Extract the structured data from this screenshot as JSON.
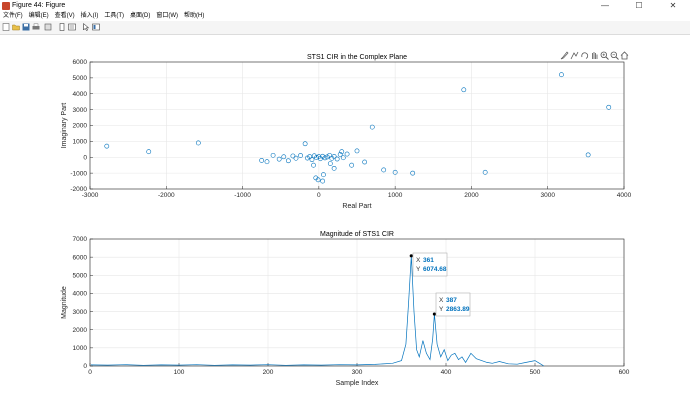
{
  "window": {
    "title": "Figure 44: Figure",
    "minimize_label": "—",
    "maximize_label": "☐",
    "close_label": "✕"
  },
  "menu": [
    "文件(F)",
    "编辑(E)",
    "查看(V)",
    "插入(I)",
    "工具(T)",
    "桌面(D)",
    "窗口(W)",
    "帮助(H)"
  ],
  "toolbar_icons": [
    "new-figure-icon",
    "open-icon",
    "save-icon",
    "print-icon",
    "link-icon",
    "colorbar-icon",
    "legend-icon",
    "pointer-icon",
    "property-inspector-icon"
  ],
  "axes_toolbar_icons": [
    "brush-icon",
    "data-tip-icon",
    "rotate-icon",
    "pan-icon",
    "zoom-in-icon",
    "zoom-out-icon",
    "home-icon"
  ],
  "colors": {
    "series": "#0072bd",
    "grid": "#e6e6e6"
  },
  "chart_data": [
    {
      "type": "scatter",
      "title": "STS1 CIR in the Complex Plane",
      "xlabel": "Real Part",
      "ylabel": "Imaginary Part",
      "xlim": [
        -3000,
        4000
      ],
      "ylim": [
        -2000,
        6000
      ],
      "xticks": [
        "-3000",
        "-2000",
        "-1000",
        "0",
        "1000",
        "2000",
        "3000",
        "4000"
      ],
      "yticks": [
        "-2000",
        "-1000",
        "0",
        "1000",
        "2000",
        "3000",
        "4000",
        "5000",
        "6000"
      ],
      "grid": true,
      "points": [
        [
          -2780,
          700
        ],
        [
          -2230,
          350
        ],
        [
          -1580,
          900
        ],
        [
          -750,
          -200
        ],
        [
          -680,
          -280
        ],
        [
          -600,
          120
        ],
        [
          -520,
          -120
        ],
        [
          -460,
          30
        ],
        [
          -400,
          -220
        ],
        [
          -340,
          80
        ],
        [
          -300,
          -60
        ],
        [
          -240,
          110
        ],
        [
          -180,
          850
        ],
        [
          -150,
          -50
        ],
        [
          -120,
          40
        ],
        [
          -90,
          -150
        ],
        [
          -60,
          90
        ],
        [
          -30,
          -20
        ],
        [
          0,
          40
        ],
        [
          20,
          -90
        ],
        [
          50,
          60
        ],
        [
          80,
          -40
        ],
        [
          110,
          20
        ],
        [
          140,
          120
        ],
        [
          170,
          -70
        ],
        [
          200,
          50
        ],
        [
          240,
          -110
        ],
        [
          280,
          180
        ],
        [
          320,
          -30
        ],
        [
          -70,
          -500
        ],
        [
          -40,
          -1300
        ],
        [
          -10,
          -1420
        ],
        [
          50,
          -1500
        ],
        [
          60,
          -1100
        ],
        [
          150,
          -400
        ],
        [
          200,
          -700
        ],
        [
          300,
          350
        ],
        [
          370,
          200
        ],
        [
          430,
          -500
        ],
        [
          500,
          400
        ],
        [
          600,
          -300
        ],
        [
          700,
          1900
        ],
        [
          850,
          -800
        ],
        [
          1000,
          -950
        ],
        [
          1230,
          -1000
        ],
        [
          1900,
          4250
        ],
        [
          2180,
          -950
        ],
        [
          3180,
          5200
        ],
        [
          3530,
          150
        ],
        [
          3800,
          3150
        ]
      ]
    },
    {
      "type": "line",
      "title": "Magnitude of STS1 CIR",
      "xlabel": "Sample Index",
      "ylabel": "Magnitude",
      "xlim": [
        0,
        600
      ],
      "ylim": [
        0,
        7000
      ],
      "xticks": [
        "0",
        "100",
        "200",
        "300",
        "400",
        "500",
        "600"
      ],
      "yticks": [
        "0",
        "1000",
        "2000",
        "3000",
        "4000",
        "5000",
        "6000",
        "7000"
      ],
      "grid": true,
      "x": [
        1,
        20,
        40,
        60,
        80,
        100,
        120,
        140,
        160,
        180,
        200,
        220,
        240,
        260,
        280,
        300,
        320,
        340,
        350,
        355,
        358,
        361,
        364,
        367,
        370,
        374,
        378,
        382,
        385,
        387,
        390,
        394,
        398,
        402,
        406,
        410,
        414,
        418,
        422,
        428,
        434,
        440,
        446,
        452,
        460,
        470,
        480,
        490,
        500,
        505,
        510
      ],
      "y": [
        60,
        50,
        70,
        40,
        60,
        50,
        70,
        40,
        60,
        50,
        70,
        40,
        60,
        50,
        70,
        60,
        90,
        150,
        300,
        1200,
        3500,
        6074.68,
        3000,
        900,
        500,
        1400,
        700,
        350,
        1500,
        2863.89,
        1200,
        500,
        900,
        300,
        600,
        700,
        350,
        500,
        200,
        700,
        400,
        300,
        200,
        150,
        250,
        120,
        100,
        200,
        300,
        150,
        0
      ],
      "datatips": [
        {
          "x_label": "X",
          "x_value": "361",
          "y_label": "Y",
          "y_value": "6074.68",
          "x": 361,
          "y": 6074.68
        },
        {
          "x_label": "X",
          "x_value": "387",
          "y_label": "Y",
          "y_value": "2863.89",
          "x": 387,
          "y": 2863.89
        }
      ]
    }
  ]
}
